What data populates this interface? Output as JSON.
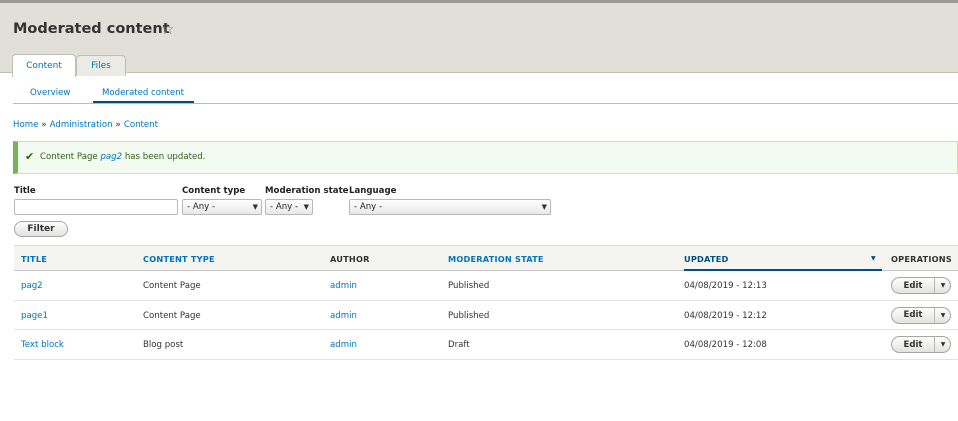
{
  "header": {
    "title": "Moderated content",
    "tabs": [
      {
        "label": "Content"
      },
      {
        "label": "Files"
      }
    ]
  },
  "subtabs": [
    {
      "label": "Overview"
    },
    {
      "label": "Moderated content"
    }
  ],
  "breadcrumb": {
    "items": [
      "Home",
      "Administration",
      "Content"
    ],
    "separator": "»"
  },
  "message": {
    "prefix": "Content Page",
    "link": "pag2",
    "suffix": "has been updated."
  },
  "filters": {
    "title_label": "Title",
    "title_value": "",
    "content_type_label": "Content type",
    "content_type_value": "- Any -",
    "moderation_state_label": "Moderation state",
    "moderation_state_value": "- Any -",
    "language_label": "Language",
    "language_value": "- Any -",
    "filter_button": "Filter"
  },
  "table": {
    "columns": [
      "Title",
      "Content type",
      "Author",
      "Moderation state",
      "Updated",
      "Operations"
    ],
    "rows": [
      {
        "title": "pag2",
        "content_type": "Content Page",
        "author": "admin",
        "state": "Published",
        "updated": "04/08/2019 - 12:13"
      },
      {
        "title": "page1",
        "content_type": "Content Page",
        "author": "admin",
        "state": "Published",
        "updated": "04/08/2019 - 12:12"
      },
      {
        "title": "Text block",
        "content_type": "Blog post",
        "author": "admin",
        "state": "Draft",
        "updated": "04/08/2019 - 12:08"
      }
    ],
    "edit_label": "Edit"
  },
  "icons": {
    "favorite": "star-outline-icon",
    "success": "check-icon",
    "sort": "caret-down-icon",
    "dropdown": "caret-down-icon"
  },
  "colors": {
    "link": "#0074bd",
    "header_bg": "#e0e0d8",
    "success_bar": "#77b259"
  }
}
